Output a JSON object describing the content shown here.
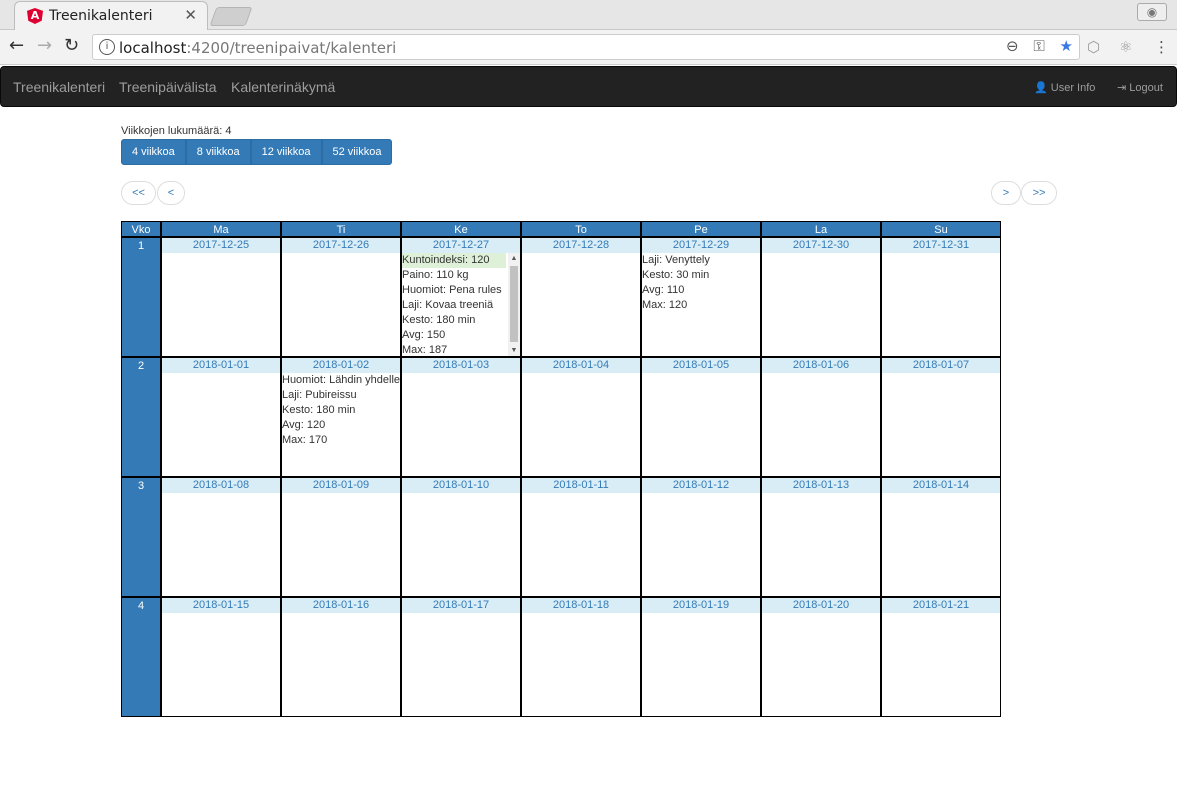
{
  "browser": {
    "tab_title": "Treenikalenteri",
    "url_host": "localhost",
    "url_path": ":4200/treenipaivat/kalenteri"
  },
  "navbar": {
    "links": [
      "Treenikalenteri",
      "Treenipäivälista",
      "Kalenterinäkymä"
    ],
    "user_info": "User Info",
    "logout": "Logout"
  },
  "weeks_label": "Viikkojen lukumäärä: 4",
  "week_buttons": [
    "4 viikkoa",
    "8 viikkoa",
    "12 viikkoa",
    "52 viikkoa"
  ],
  "pager": {
    "first": "<<",
    "prev": "<",
    "next": ">",
    "last": ">>"
  },
  "calendar": {
    "headers": [
      "Vko",
      "Ma",
      "Ti",
      "Ke",
      "To",
      "Pe",
      "La",
      "Su"
    ],
    "weeks": [
      {
        "number": "1",
        "days": [
          {
            "date": "2017-12-25",
            "entries": []
          },
          {
            "date": "2017-12-26",
            "entries": []
          },
          {
            "date": "2017-12-27",
            "entries": [
              "Kuntoindeksi: 120",
              "Paino: 110 kg",
              "Huomiot: Pena rules",
              "Laji: Kovaa treeniä",
              "Kesto: 180 min",
              "Avg: 150",
              "Max: 187"
            ],
            "highlight_first": true,
            "scrollable": true
          },
          {
            "date": "2017-12-28",
            "entries": []
          },
          {
            "date": "2017-12-29",
            "entries": [
              "Laji: Venyttely",
              "Kesto: 30 min",
              "Avg: 110",
              "Max: 120"
            ]
          },
          {
            "date": "2017-12-30",
            "entries": []
          },
          {
            "date": "2017-12-31",
            "entries": []
          }
        ]
      },
      {
        "number": "2",
        "days": [
          {
            "date": "2018-01-01",
            "entries": []
          },
          {
            "date": "2018-01-02",
            "entries": [
              "Huomiot: Lähdin yhdelle",
              "Laji: Pubireissu",
              "Kesto: 180 min",
              "Avg: 120",
              "Max: 170"
            ]
          },
          {
            "date": "2018-01-03",
            "entries": []
          },
          {
            "date": "2018-01-04",
            "entries": []
          },
          {
            "date": "2018-01-05",
            "entries": []
          },
          {
            "date": "2018-01-06",
            "entries": []
          },
          {
            "date": "2018-01-07",
            "entries": []
          }
        ]
      },
      {
        "number": "3",
        "days": [
          {
            "date": "2018-01-08",
            "entries": []
          },
          {
            "date": "2018-01-09",
            "entries": []
          },
          {
            "date": "2018-01-10",
            "entries": []
          },
          {
            "date": "2018-01-11",
            "entries": []
          },
          {
            "date": "2018-01-12",
            "entries": []
          },
          {
            "date": "2018-01-13",
            "entries": []
          },
          {
            "date": "2018-01-14",
            "entries": []
          }
        ]
      },
      {
        "number": "4",
        "days": [
          {
            "date": "2018-01-15",
            "entries": []
          },
          {
            "date": "2018-01-16",
            "entries": []
          },
          {
            "date": "2018-01-17",
            "entries": []
          },
          {
            "date": "2018-01-18",
            "entries": []
          },
          {
            "date": "2018-01-19",
            "entries": []
          },
          {
            "date": "2018-01-20",
            "entries": []
          },
          {
            "date": "2018-01-21",
            "entries": []
          }
        ]
      }
    ]
  },
  "colors": {
    "primary": "#337ab7",
    "date_bg": "#d9edf7",
    "highlight": "#dff0d8",
    "navbar_bg": "#222222"
  }
}
